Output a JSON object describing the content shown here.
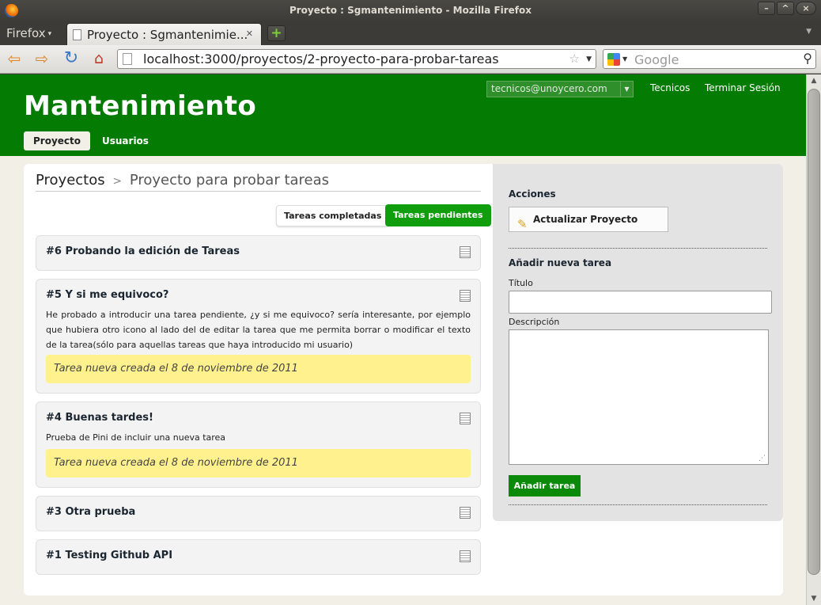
{
  "window": {
    "title": "Proyecto : Sgmantenimiento - Mozilla Firefox",
    "buttons": [
      "–",
      "^",
      "×"
    ]
  },
  "browser": {
    "menu_label": "Firefox",
    "tab_title": "Proyecto : Sgmantenimie...",
    "url": "localhost:3000/proyectos/2-proyecto-para-probar-tareas",
    "search_placeholder": "Google"
  },
  "site": {
    "brand": "Mantenimiento",
    "nav": {
      "proyecto": "Proyecto",
      "usuarios": "Usuarios"
    },
    "user_select": "tecnicos@unoycero.com",
    "links": {
      "tecnicos": "Tecnicos",
      "logout": "Terminar Sesión"
    }
  },
  "breadcrumb": {
    "root": "Proyectos",
    "separator": ">",
    "current": "Proyecto para probar tareas"
  },
  "filters": {
    "completadas": "Tareas completadas",
    "pendientes": "Tareas pendientes"
  },
  "tasks": [
    {
      "title": "#6 Probando la edición de Tareas"
    },
    {
      "title": "#5 Y si me equivoco?",
      "description": "He probado a introducir una tarea pendiente, ¿y si me equivoco? sería interesante, por ejemplo que hubiera otro icono al lado del de editar la tarea que me permita borrar o modificar el texto de la tarea(sólo para aquellas tareas que haya introducido mi usuario)",
      "note": "Tarea nueva creada el 8 de noviembre de 2011"
    },
    {
      "title": "#4 Buenas tardes!",
      "description": "Prueba de Pini de incluir una nueva tarea",
      "note": "Tarea nueva creada el 8 de noviembre de 2011"
    },
    {
      "title": "#3 Otra prueba"
    },
    {
      "title": "#1 Testing Github API"
    }
  ],
  "sidebar": {
    "acciones_heading": "Acciones",
    "actualizar_button": "Actualizar Proyecto",
    "nueva_heading": "Añadir nueva tarea",
    "titulo_label": "Título",
    "descripcion_label": "Descripción",
    "titulo_value": "",
    "descripcion_value": "",
    "submit_button": "Añadir tarea"
  },
  "colors": {
    "header_green": "#047c03",
    "button_green": "#109d0e",
    "note_yellow": "#fff28e",
    "page_bg": "#f1efe6"
  }
}
